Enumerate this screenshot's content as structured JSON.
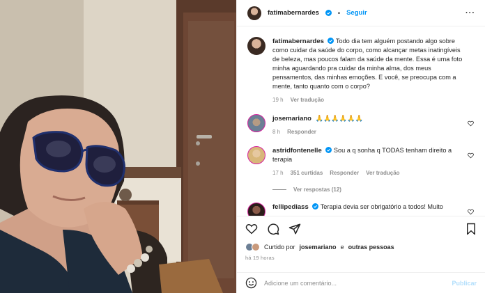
{
  "post": {
    "author": "fatimabernardes",
    "follow_label": "Seguir",
    "more_label": "···",
    "caption": "Todo dia tem alguém postando algo sobre como cuidar da saúde do corpo, como alcançar metas inatingíveis de beleza, mas poucos falam da saúde da mente. Essa é uma foto minha aguardando pra cuidar da minha alma, dos meus pensamentos, das minhas emoções. E você, se preocupa com a mente, tanto quanto com o corpo?",
    "caption_time": "19 h",
    "caption_translate": "Ver tradução"
  },
  "comments": [
    {
      "username": "josemariano",
      "text": "🙏🙏🙏🙏🙏🙏",
      "time": "8 h",
      "reply": "Responder"
    },
    {
      "username": "astridfontenelle",
      "text": "Sou a q sonha q TODAS tenham direito a terapia",
      "time": "17 h",
      "likes": "351 curtidas",
      "reply": "Responder",
      "translate": "Ver tradução",
      "view_replies": "Ver respostas (12)"
    },
    {
      "username": "fellipediass",
      "text": "Terapia devia ser obrigatório a todos! Muito"
    }
  ],
  "likes_line": {
    "prefix": "Curtido por",
    "user": "josemariano",
    "middle": "e",
    "others": "outras pessoas"
  },
  "posted_ago": "há 19 horas",
  "comment_box": {
    "placeholder": "Adicione um comentário...",
    "publish_label": "Publicar"
  },
  "colors": {
    "accent": "#0095f6",
    "verified": "#0095f6",
    "muted": "#8e8e8e",
    "publish_disabled": "#b2dffc"
  }
}
